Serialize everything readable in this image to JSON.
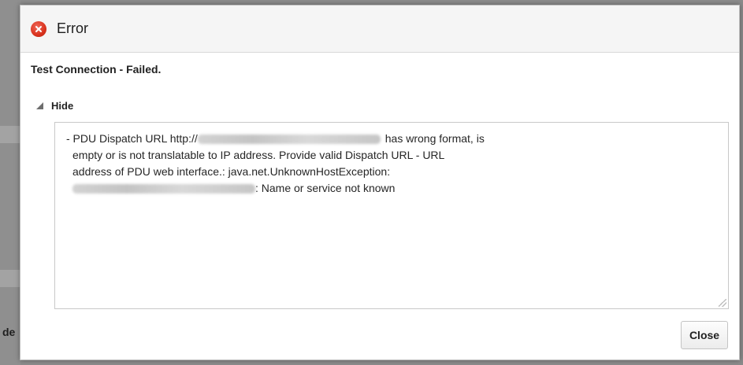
{
  "background": {
    "fragment_text": "de"
  },
  "dialog": {
    "icon": "error-icon",
    "title": "Error",
    "message": "Test Connection - Failed.",
    "toggle_label": "Hide",
    "details": {
      "line1_prefix": "- PDU Dispatch URL http://",
      "line1_suffix": "has wrong format, is",
      "line2": "empty or is not translatable to IP address. Provide valid Dispatch URL - URL",
      "line3": "address of PDU web interface.: java.net.UnknownHostException:",
      "line4_suffix": ": Name or service not known"
    },
    "close_label": "Close"
  },
  "colors": {
    "error_red": "#d9321d",
    "header_bg": "#f5f5f5",
    "overlay_gray": "#8c8c8c"
  }
}
